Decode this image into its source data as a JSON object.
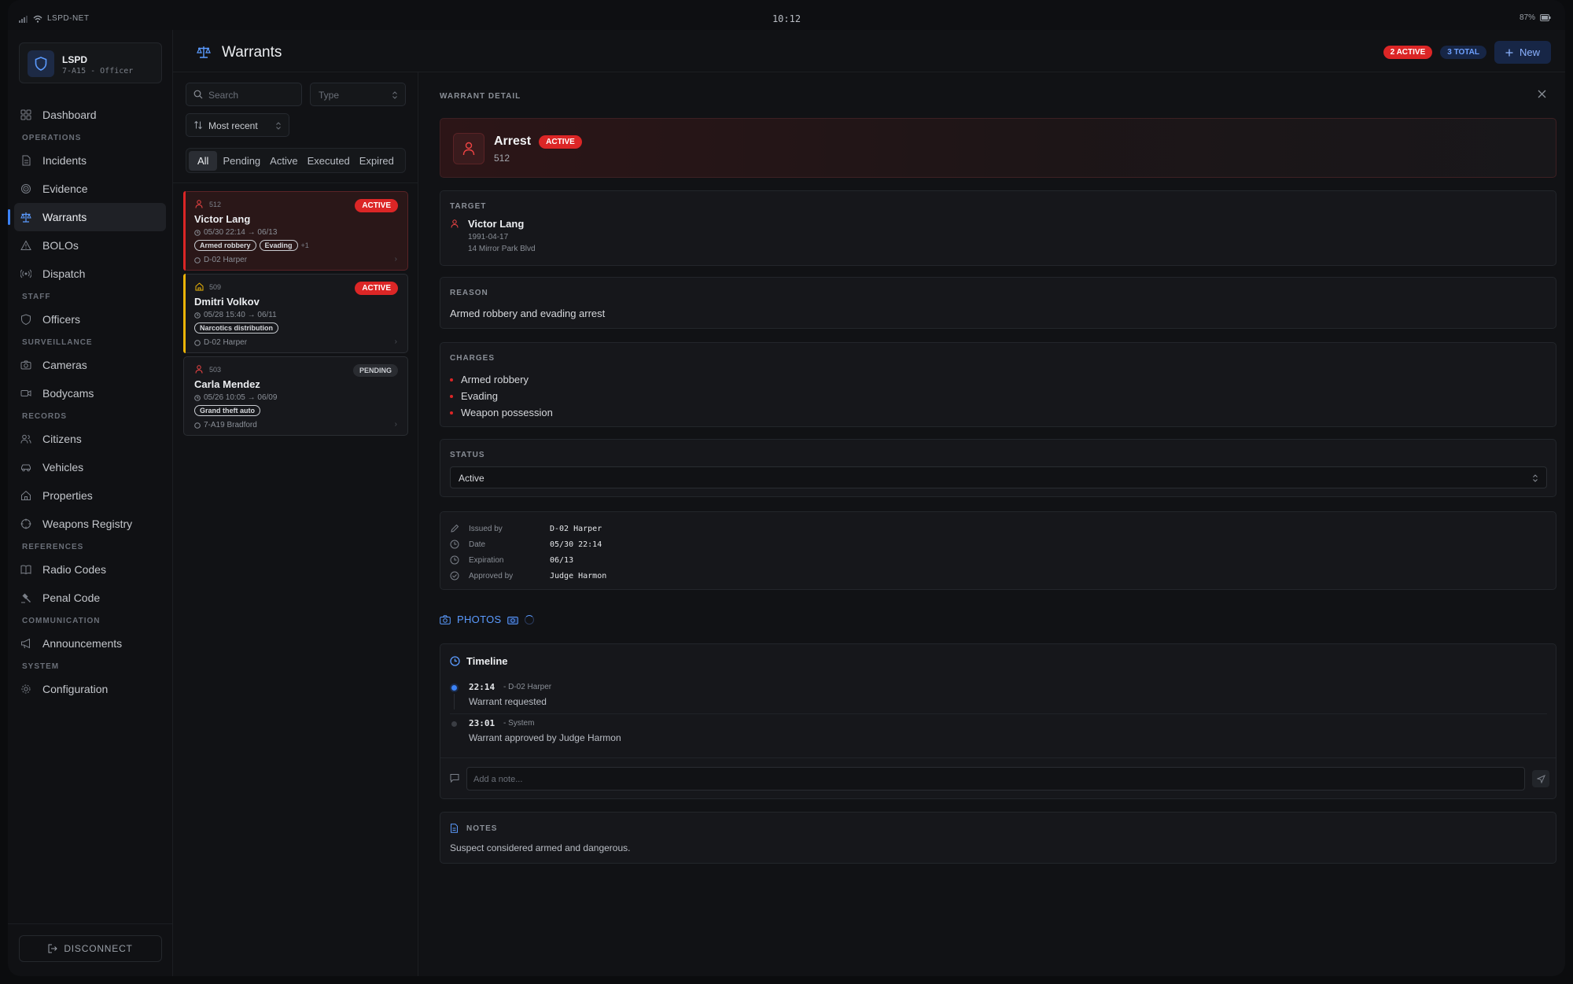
{
  "statusbar": {
    "network": "LSPD-NET",
    "time": "10:12",
    "battery": "87%"
  },
  "org": {
    "name": "LSPD",
    "unit": "7-A15 - Officer"
  },
  "nav": {
    "dashboard": "Dashboard",
    "sec_operations": "OPERATIONS",
    "incidents": "Incidents",
    "evidence": "Evidence",
    "warrants": "Warrants",
    "bolos": "BOLOs",
    "dispatch": "Dispatch",
    "sec_staff": "STAFF",
    "officers": "Officers",
    "sec_surveillance": "SURVEILLANCE",
    "cameras": "Cameras",
    "bodycams": "Bodycams",
    "sec_records": "RECORDS",
    "citizens": "Citizens",
    "vehicles": "Vehicles",
    "properties": "Properties",
    "weapons": "Weapons Registry",
    "sec_references": "REFERENCES",
    "radio": "Radio Codes",
    "penal": "Penal Code",
    "sec_communication": "COMMUNICATION",
    "announcements": "Announcements",
    "sec_system": "SYSTEM",
    "configuration": "Configuration"
  },
  "disconnect": "DISCONNECT",
  "header": {
    "title": "Warrants",
    "active_badge": "2 ACTIVE",
    "total_badge": "3 TOTAL",
    "new_label": "New"
  },
  "list": {
    "search_placeholder": "Search",
    "type_placeholder": "Type",
    "sort_label": "Most recent",
    "filters": [
      "All",
      "Pending",
      "Active",
      "Executed",
      "Expired"
    ],
    "cards": [
      {
        "num": "512",
        "name": "Victor Lang",
        "dates": "05/30 22:14 → 06/13",
        "tags": [
          "Armed robbery",
          "Evading"
        ],
        "more": "+1",
        "officer": "D-02 Harper",
        "status": "ACTIVE"
      },
      {
        "num": "509",
        "name": "Dmitri Volkov",
        "dates": "05/28 15:40 → 06/11",
        "tags": [
          "Narcotics distribution"
        ],
        "more": "",
        "officer": "D-02 Harper",
        "status": "ACTIVE"
      },
      {
        "num": "503",
        "name": "Carla Mendez",
        "dates": "05/26 10:05 → 06/09",
        "tags": [
          "Grand theft auto"
        ],
        "more": "",
        "officer": "7-A19 Bradford",
        "status": "PENDING"
      }
    ]
  },
  "detail": {
    "heading": "WARRANT DETAIL",
    "type": "Arrest",
    "status_badge": "ACTIVE",
    "number": "512",
    "target_label": "TARGET",
    "target_name": "Victor Lang",
    "target_dob": "1991-04-17",
    "target_address": "14 Mirror Park Blvd",
    "reason_label": "REASON",
    "reason": "Armed robbery and evading arrest",
    "charges_label": "CHARGES",
    "charges": [
      "Armed robbery",
      "Evading",
      "Weapon possession"
    ],
    "status_label": "STATUS",
    "status_value": "Active",
    "meta": [
      {
        "key": "Issued by",
        "value": "D-02 Harper"
      },
      {
        "key": "Date",
        "value": "05/30 22:14"
      },
      {
        "key": "Expiration",
        "value": "06/13"
      },
      {
        "key": "Approved by",
        "value": "Judge Harmon"
      }
    ],
    "photos_label": "PHOTOS",
    "timeline_label": "Timeline",
    "timeline": [
      {
        "time": "22:14",
        "by": "- D-02 Harper",
        "message": "Warrant requested"
      },
      {
        "time": "23:01",
        "by": "- System",
        "message": "Warrant approved by Judge Harmon"
      }
    ],
    "note_placeholder": "Add a note...",
    "notes_label": "NOTES",
    "notes": "Suspect considered armed and dangerous."
  },
  "colors": {
    "accent": "#3b82f6",
    "danger": "#dc2626",
    "warning": "#eab308"
  }
}
